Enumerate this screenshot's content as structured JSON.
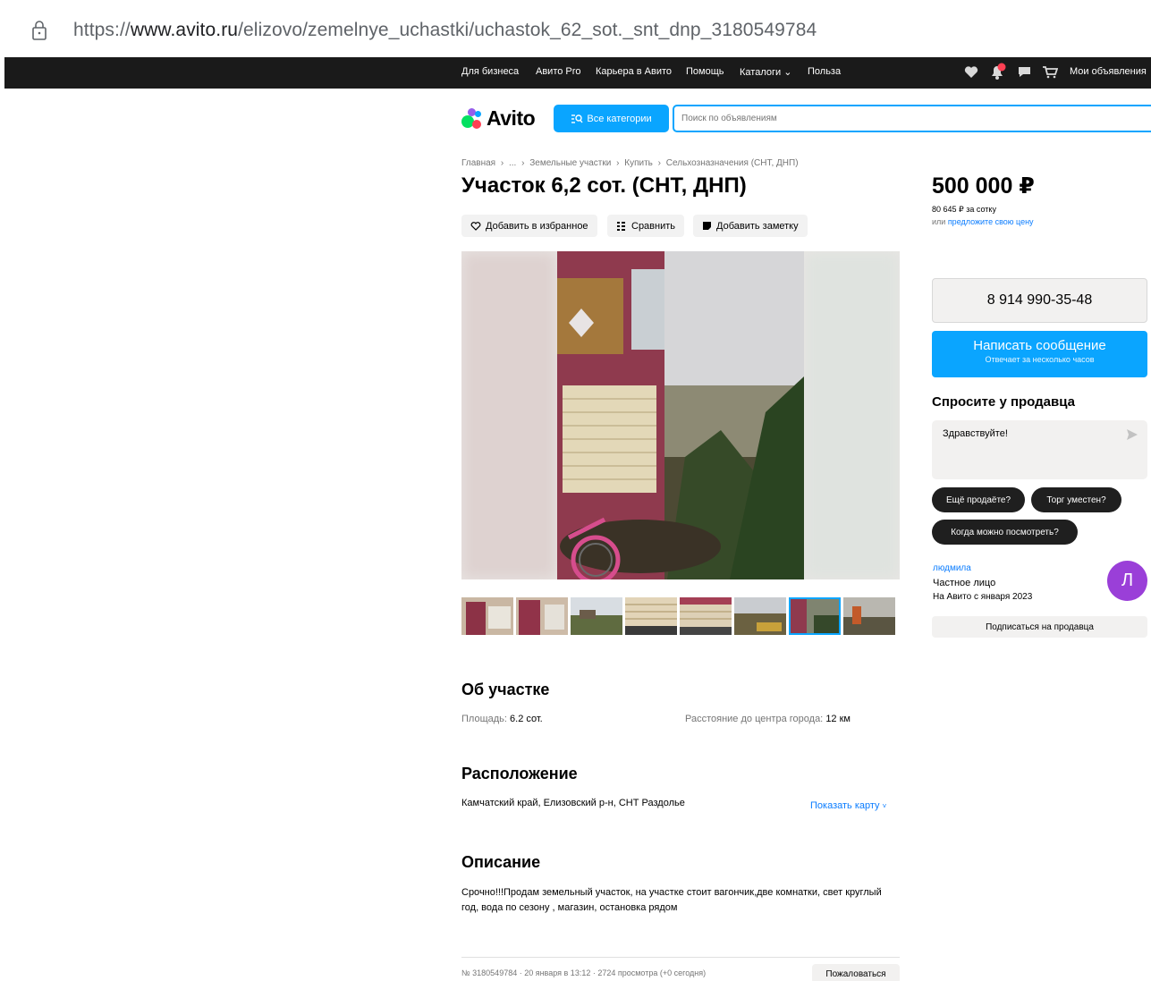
{
  "browser": {
    "url_prefix": "https://",
    "url_domain": "www.avito.ru",
    "url_path": "/elizovo/zemelnye_uchastki/uchastok_62_sot._snt_dnp_3180549784"
  },
  "topnav": {
    "links": [
      "Для бизнеса",
      "Авито Pro",
      "Карьера в Авито",
      "Помощь",
      "Каталоги",
      "Польза"
    ],
    "catalog_chevron": "⌄",
    "my_ads": "Мои объявления",
    "icons": [
      "heart-icon",
      "bell-icon",
      "chat-icon",
      "cart-icon"
    ]
  },
  "header": {
    "logo_text": "Avito",
    "categories_label": "Все категории",
    "search_placeholder": "Поиск по объявлениям"
  },
  "breadcrumb": [
    "Главная",
    "›",
    "...",
    "›",
    "Земельные участки",
    "›",
    "Купить",
    "›",
    "Сельхозназначения (СНТ, ДНП)"
  ],
  "listing": {
    "title": "Участок 6,2 сот. (СНТ, ДНП)",
    "actions": {
      "favorite": "Добавить в избранное",
      "compare": "Сравнить",
      "note": "Добавить заметку"
    },
    "thumbnail_count": 8,
    "selected_thumbnail": 7
  },
  "pricing": {
    "price": "500 000 ₽",
    "per_sotka": "80 645 ₽ за сотку",
    "offer_prefix": "или ",
    "offer_link": "предложите свою цену"
  },
  "contact": {
    "phone": "8 914 990-35-48",
    "message_label": "Написать сообщение",
    "message_sub": "Отвечает за несколько часов",
    "ask_title": "Спросите у продавца",
    "ask_text": "Здравствуйте!",
    "chips": [
      "Ещё продаёте?",
      "Торг уместен?",
      "Когда можно посмотреть?"
    ]
  },
  "seller": {
    "name": "людмила",
    "type": "Частное лицо",
    "since": "На Авито с января 2023",
    "avatar_letter": "Л",
    "subscribe": "Подписаться на продавца"
  },
  "about": {
    "title": "Об участке",
    "area_label": "Площадь:",
    "area_value": "6.2 сот.",
    "distance_label": "Расстояние до центра города:",
    "distance_value": "12 км"
  },
  "location": {
    "title": "Расположение",
    "address": "Камчатский край, Елизовский р-н, СНТ Раздолье",
    "show_map": "Показать карту"
  },
  "description": {
    "title": "Описание",
    "text": "Срочно!!!Продам земельный участок, на участке стоит вагончик,две комнатки, свет круглый год, вода по сезону , магазин, остановка рядом"
  },
  "footer": {
    "meta": "№ 3180549784 · 20 января в 13:12 · 2724 просмотра (+0 сегодня)",
    "report": "Пожаловаться"
  },
  "colors": {
    "accent": "#0aa5ff",
    "link": "#0a7cff",
    "topnav_bg": "#1a1a1a",
    "avatar_bg": "#9a3fd8"
  }
}
